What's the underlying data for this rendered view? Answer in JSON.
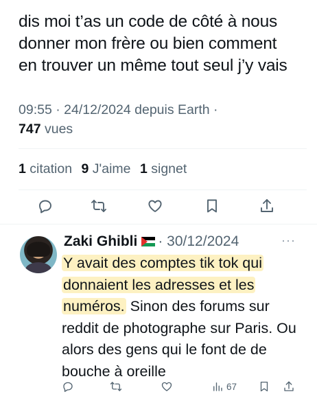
{
  "tweet": {
    "text": "dis moi t’as un code de côté à nous\ndonner mon frère ou bien comment\nen trouver un même tout seul j’y vais",
    "meta": "09:55 · 24/12/2024 depuis Earth ·",
    "views_count": "747",
    "views_label": "vues",
    "stats": {
      "quotes_count": "1",
      "quotes_label": "citation",
      "likes_count": "9",
      "likes_label": "J'aime",
      "bookmarks_count": "1",
      "bookmarks_label": "signet"
    },
    "actions": [
      "reply-icon",
      "retweet-icon",
      "like-icon",
      "bookmark-icon",
      "share-icon"
    ]
  },
  "reply": {
    "author": "Zaki Ghibli",
    "flag": "palestine-flag-emoji",
    "date": "· 30/12/2024",
    "more": "···",
    "text_highlight_1": "Y avait des comptes tik tok qui",
    "text_highlight_2": "donnaient les adresses et les",
    "text_highlight_3": "numéros.",
    "text_rest": " Sinon des forums sur reddit de photographe sur Paris. Ou alors des gens qui le font de de bouche à oreille",
    "views_count": "67",
    "actions": [
      "reply-icon",
      "retweet-icon",
      "like-icon",
      "views-icon",
      "bookmark-icon",
      "share-icon"
    ]
  },
  "colors": {
    "text": "#0f1419",
    "secondary": "#536471",
    "highlight": "#fdf1c2",
    "divider": "#eff3f4"
  }
}
